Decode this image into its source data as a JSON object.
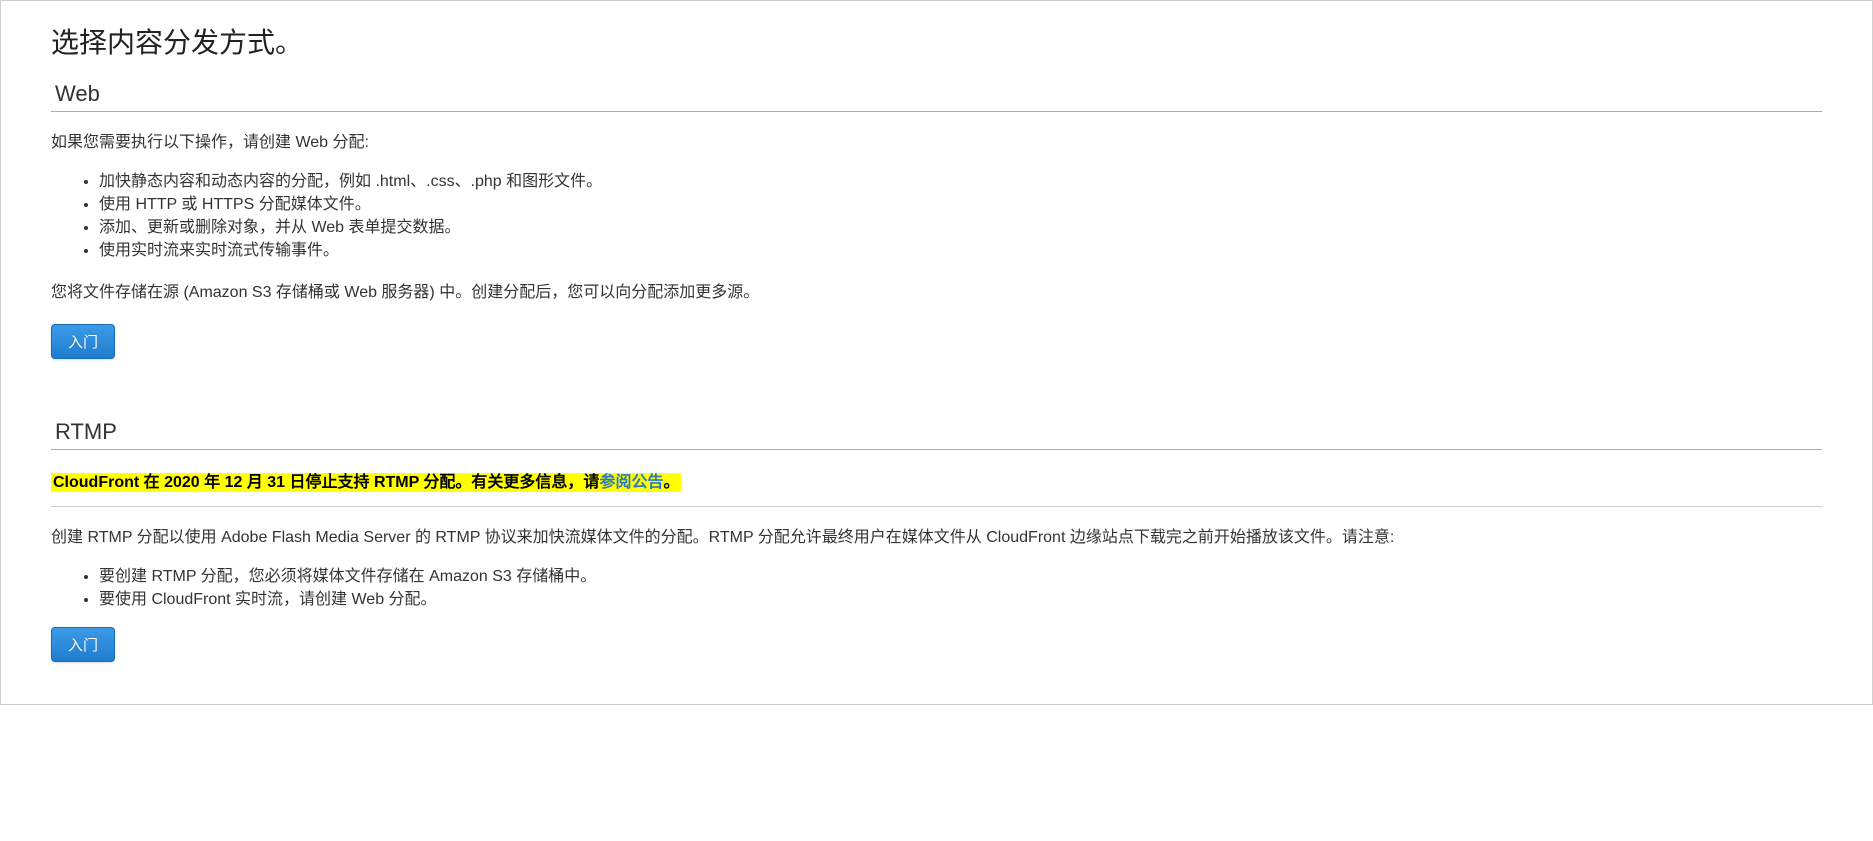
{
  "page": {
    "title": "选择内容分发方式。"
  },
  "web": {
    "header": "Web",
    "intro": "如果您需要执行以下操作，请创建 Web 分配:",
    "bullets": [
      "加快静态内容和动态内容的分配，例如 .html、.css、.php 和图形文件。",
      "使用 HTTP 或 HTTPS 分配媒体文件。",
      "添加、更新或删除对象，并从 Web 表单提交数据。",
      "使用实时流来实时流式传输事件。"
    ],
    "storage_note": "您将文件存储在源 (Amazon S3 存储桶或 Web 服务器) 中。创建分配后，您可以向分配添加更多源。",
    "button_label": "入门"
  },
  "rtmp": {
    "header": "RTMP",
    "notice_pre": "CloudFront 在 2020 年 12 月 31 日停止支持 RTMP 分配。有关更多信息，请",
    "notice_link": "参阅公告",
    "notice_post": "。",
    "intro": "创建 RTMP 分配以使用 Adobe Flash Media Server 的 RTMP 协议来加快流媒体文件的分配。RTMP 分配允许最终用户在媒体文件从 CloudFront 边缘站点下载完之前开始播放该文件。请注意:",
    "bullets": [
      "要创建 RTMP 分配，您必须将媒体文件存储在 Amazon S3 存储桶中。",
      "要使用 CloudFront 实时流，请创建 Web 分配。"
    ],
    "button_label": "入门"
  }
}
